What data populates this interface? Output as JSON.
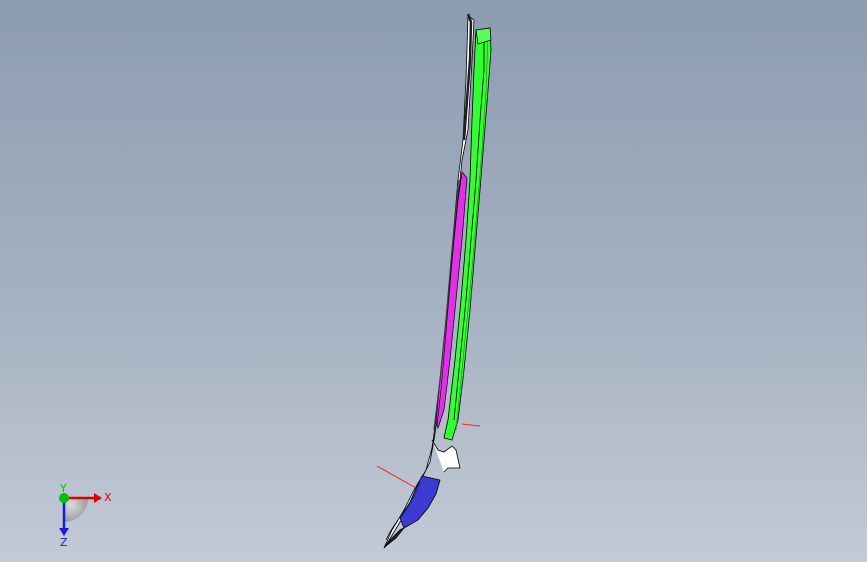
{
  "viewport": {
    "background_top": "#8c9cb0",
    "background_bottom": "#c3cad6"
  },
  "model": {
    "parts": [
      {
        "name": "green-rail",
        "color": "#33ff33"
      },
      {
        "name": "magenta-strip",
        "color": "#e030e8"
      },
      {
        "name": "blue-end-cap",
        "color": "#3b3bd0"
      }
    ],
    "highlight_color": "#ff2020",
    "edge_color": "#000000"
  },
  "triad": {
    "x_label": "X",
    "y_label": "Y",
    "z_label": "Z",
    "x_color": "#e00000",
    "y_color": "#00c000",
    "z_color": "#1a1ad8",
    "x_icon": "x-axis-arrow-icon",
    "y_icon": "y-axis-dot-icon",
    "z_icon": "z-axis-arrow-icon"
  }
}
